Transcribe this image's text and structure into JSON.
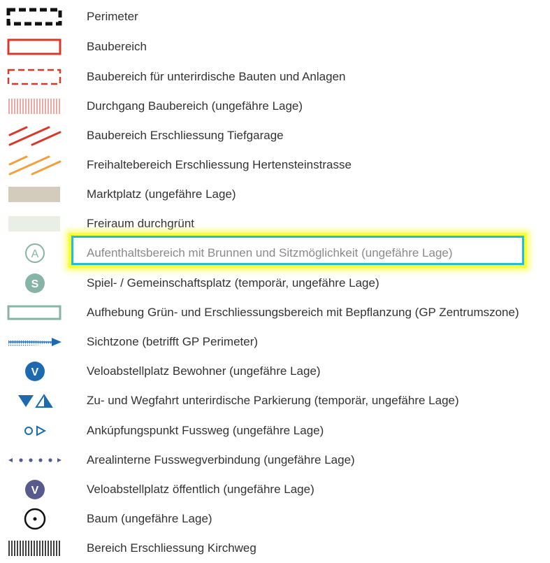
{
  "legend": {
    "items": [
      {
        "symbol": "perimeter-dashed-black",
        "label": "Perimeter"
      },
      {
        "symbol": "solid-red-rectangle",
        "label": "Baubereich"
      },
      {
        "symbol": "dashed-red-rectangle",
        "label": "Baubereich für unterirdische Bauten und Anlagen"
      },
      {
        "symbol": "red-vertical-hatch",
        "label": "Durchgang Baubereich (ungefähre Lage)"
      },
      {
        "symbol": "red-diagonal-lines",
        "label": "Baubereich Erschliessung Tiefgarage"
      },
      {
        "symbol": "orange-diagonal-lines",
        "label": "Freihaltebereich Erschliessung Hertensteinstrasse"
      },
      {
        "symbol": "tan-filled-rectangle",
        "label": "Marktplatz (ungefähre Lage)"
      },
      {
        "symbol": "pale-green-rectangle",
        "label": "Freiraum durchgrünt"
      },
      {
        "symbol": "circle-letter-a",
        "letter": "A",
        "label": "Aufenthaltsbereich mit Brunnen und Sitzmöglichkeit (ungefähre Lage)",
        "highlighted": true
      },
      {
        "symbol": "filled-circle-letter-s",
        "letter": "S",
        "label": "Spiel- / Gemeinschaftsplatz (temporär, ungefähre Lage)"
      },
      {
        "symbol": "green-outline-rectangle",
        "label": "Aufhebung Grün- und Erschliessungsbereich mit Bepflanzung (GP Zentrumszone)"
      },
      {
        "symbol": "blue-sight-arrow",
        "label": "Sichtzone (betrifft GP Perimeter)"
      },
      {
        "symbol": "blue-circle-letter-v",
        "letter": "V",
        "label": "Veloabstellplatz Bewohner (ungefähre Lage)"
      },
      {
        "symbol": "blue-triangles",
        "label": "Zu- und Wegfahrt unterirdische Parkierung (temporär, ungefähre Lage)"
      },
      {
        "symbol": "blue-circle-triangle",
        "label": "Ankúpfungspunkt Fussweg (ungefähre Lage)"
      },
      {
        "symbol": "blue-dot-arrow-line",
        "label": "Arealinterne Fusswegverbindung (ungefähre Lage)"
      },
      {
        "symbol": "purple-circle-letter-v",
        "letter": "V",
        "label": "Veloabstellplatz öffentlich (ungefähre Lage)"
      },
      {
        "symbol": "circle-dot-black",
        "label": "Baum (ungefähre Lage)"
      },
      {
        "symbol": "black-vertical-hatch",
        "label": "Bereich Erschliessung Kirchweg"
      }
    ]
  },
  "colors": {
    "red": "#d8392b",
    "orange": "#f0a23f",
    "tan": "#d3ccbc",
    "pale_green": "#e9efe4",
    "teal": "#86b4a7",
    "blue": "#1c6bb0",
    "purple": "#565a8c",
    "text": "#333333",
    "highlight_border": "#22bfd3",
    "highlight_glow": "#f6ff3a"
  }
}
